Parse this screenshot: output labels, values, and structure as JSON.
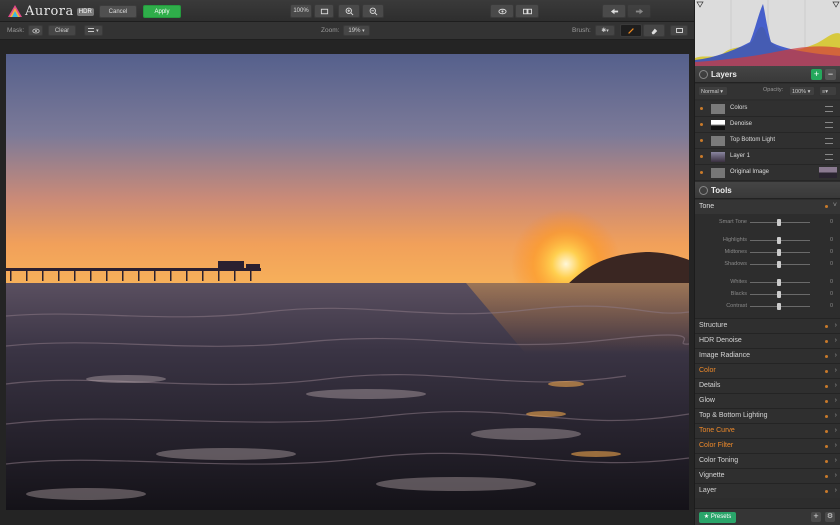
{
  "app": {
    "name": "Aurora",
    "badge": "HDR"
  },
  "toolbar": {
    "cancel": "Cancel",
    "apply": "Apply",
    "zoom_fit": "100%"
  },
  "maskbar": {
    "mask_label": "Mask:",
    "clear": "Clear",
    "zoom_label": "Zoom:",
    "zoom_value": "19%",
    "brush_label": "Brush:"
  },
  "colors": {
    "accent_green": "#2fae4a",
    "accent_orange": "#ef8a2a",
    "brush_orange": "#c05a12"
  },
  "layers": {
    "title": "Layers",
    "blend": "Normal",
    "opacity_label": "Opacity:",
    "opacity_value": "100%",
    "items": [
      {
        "name": "Colors"
      },
      {
        "name": "Denoise"
      },
      {
        "name": "Top Bottom Light"
      },
      {
        "name": "Layer 1"
      },
      {
        "name": "Original Image"
      }
    ]
  },
  "tools": {
    "title": "Tools",
    "tone": {
      "label": "Tone",
      "sliders": [
        {
          "name": "Smart Tone",
          "value": "0"
        },
        {
          "name": "Highlights",
          "value": "0"
        },
        {
          "name": "Midtones",
          "value": "0"
        },
        {
          "name": "Shadows",
          "value": "0"
        },
        {
          "name": "Whites",
          "value": "0"
        },
        {
          "name": "Blacks",
          "value": "0"
        },
        {
          "name": "Contrast",
          "value": "0"
        }
      ]
    },
    "sections": [
      {
        "name": "Structure",
        "highlight": false
      },
      {
        "name": "HDR Denoise",
        "highlight": false
      },
      {
        "name": "Image Radiance",
        "highlight": false
      },
      {
        "name": "Color",
        "highlight": true
      },
      {
        "name": "Details",
        "highlight": false
      },
      {
        "name": "Glow",
        "highlight": false
      },
      {
        "name": "Top & Bottom Lighting",
        "highlight": false
      },
      {
        "name": "Tone Curve",
        "highlight": true
      },
      {
        "name": "Color Filter",
        "highlight": true
      },
      {
        "name": "Color Toning",
        "highlight": false
      },
      {
        "name": "Vignette",
        "highlight": false
      },
      {
        "name": "Layer",
        "highlight": false
      }
    ]
  },
  "footer": {
    "presets": "Presets"
  }
}
